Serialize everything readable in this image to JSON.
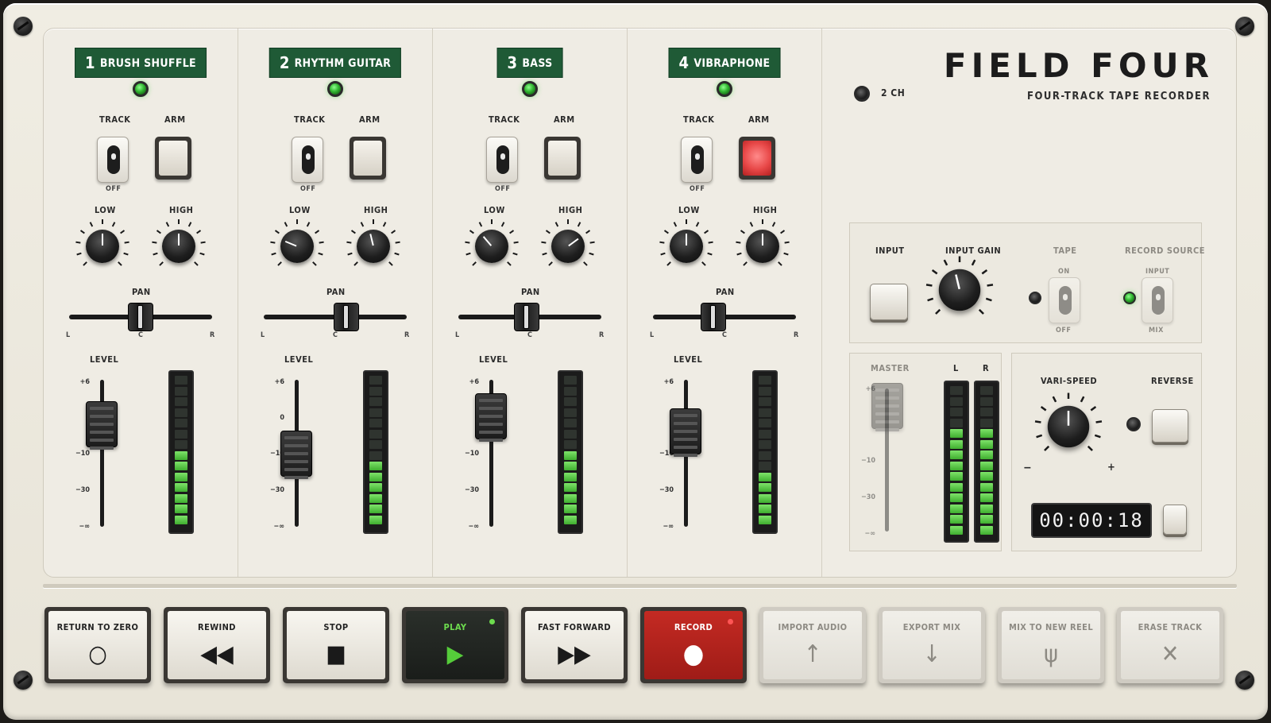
{
  "device": {
    "title": "FIELD FOUR",
    "subtitle": "FOUR-TRACK TAPE RECORDER",
    "mode_label": "2 CH"
  },
  "channels": [
    {
      "num": "1",
      "name": "BRUSH SHUFFLE",
      "track_label": "TRACK",
      "track_state": "OFF",
      "arm_label": "ARM",
      "armed": false,
      "low_label": "LOW",
      "high_label": "HIGH",
      "low_value": 0.5,
      "high_value": 0.5,
      "pan_label": "PAN",
      "pan": 0.5,
      "level_label": "LEVEL",
      "level": 0.7,
      "meter_lit": 7
    },
    {
      "num": "2",
      "name": "RHYTHM GUITAR",
      "track_label": "TRACK",
      "track_state": "OFF",
      "arm_label": "ARM",
      "armed": false,
      "low_label": "LOW",
      "high_label": "HIGH",
      "low_value": 0.25,
      "high_value": 0.45,
      "pan_label": "PAN",
      "pan": 0.58,
      "level_label": "LEVEL",
      "level": 0.5,
      "meter_lit": 6
    },
    {
      "num": "3",
      "name": "BASS",
      "track_label": "TRACK",
      "track_state": "OFF",
      "arm_label": "ARM",
      "armed": false,
      "low_label": "LOW",
      "high_label": "HIGH",
      "low_value": 0.35,
      "high_value": 0.7,
      "pan_label": "PAN",
      "pan": 0.48,
      "level_label": "LEVEL",
      "level": 0.75,
      "meter_lit": 7
    },
    {
      "num": "4",
      "name": "VIBRAPHONE",
      "track_label": "TRACK",
      "track_state": "OFF",
      "arm_label": "ARM",
      "armed": true,
      "low_label": "LOW",
      "high_label": "HIGH",
      "low_value": 0.5,
      "high_value": 0.5,
      "pan_label": "PAN",
      "pan": 0.42,
      "level_label": "LEVEL",
      "level": 0.65,
      "meter_lit": 5
    }
  ],
  "pan_marks": {
    "l": "L",
    "c": "C",
    "r": "R"
  },
  "fader_scale": [
    "+6",
    "0",
    "−10",
    "−30",
    "−∞"
  ],
  "input_section": {
    "input_label": "INPUT",
    "gain_label": "INPUT GAIN",
    "gain_value": 0.45,
    "tape_label": "TAPE",
    "tape_on": "ON",
    "tape_off": "OFF",
    "source_label": "RECORD SOURCE",
    "source_input": "INPUT",
    "source_mix": "MIX"
  },
  "master": {
    "label": "MASTER",
    "l": "L",
    "r": "R",
    "meter_l_lit": 10,
    "meter_r_lit": 10,
    "level": 0.88
  },
  "varispeed": {
    "label": "VARI-SPEED",
    "minus": "−",
    "plus": "+",
    "value": 0.5,
    "reverse_label": "REVERSE",
    "counter": "00:00:18"
  },
  "transport": [
    {
      "label": "RETURN TO ZERO",
      "glyph": "○",
      "style": "normal"
    },
    {
      "label": "REWIND",
      "glyph": "◀◀",
      "style": "normal"
    },
    {
      "label": "STOP",
      "glyph": "■",
      "style": "normal"
    },
    {
      "label": "PLAY",
      "glyph": "▶",
      "style": "play"
    },
    {
      "label": "FAST FORWARD",
      "glyph": "▶▶",
      "style": "normal"
    },
    {
      "label": "RECORD",
      "glyph": "●",
      "style": "rec"
    },
    {
      "label": "IMPORT AUDIO",
      "glyph": "↑",
      "style": "ghost"
    },
    {
      "label": "EXPORT MIX",
      "glyph": "↓",
      "style": "ghost"
    },
    {
      "label": "MIX TO NEW REEL",
      "glyph": "ψ",
      "style": "ghost"
    },
    {
      "label": "ERASE TRACK",
      "glyph": "✕",
      "style": "ghost"
    }
  ],
  "colors": {
    "label_green": "#1f5a36",
    "led_green": "#3fcf3f",
    "record_red": "#b52020",
    "play_green": "#55cc3a"
  }
}
